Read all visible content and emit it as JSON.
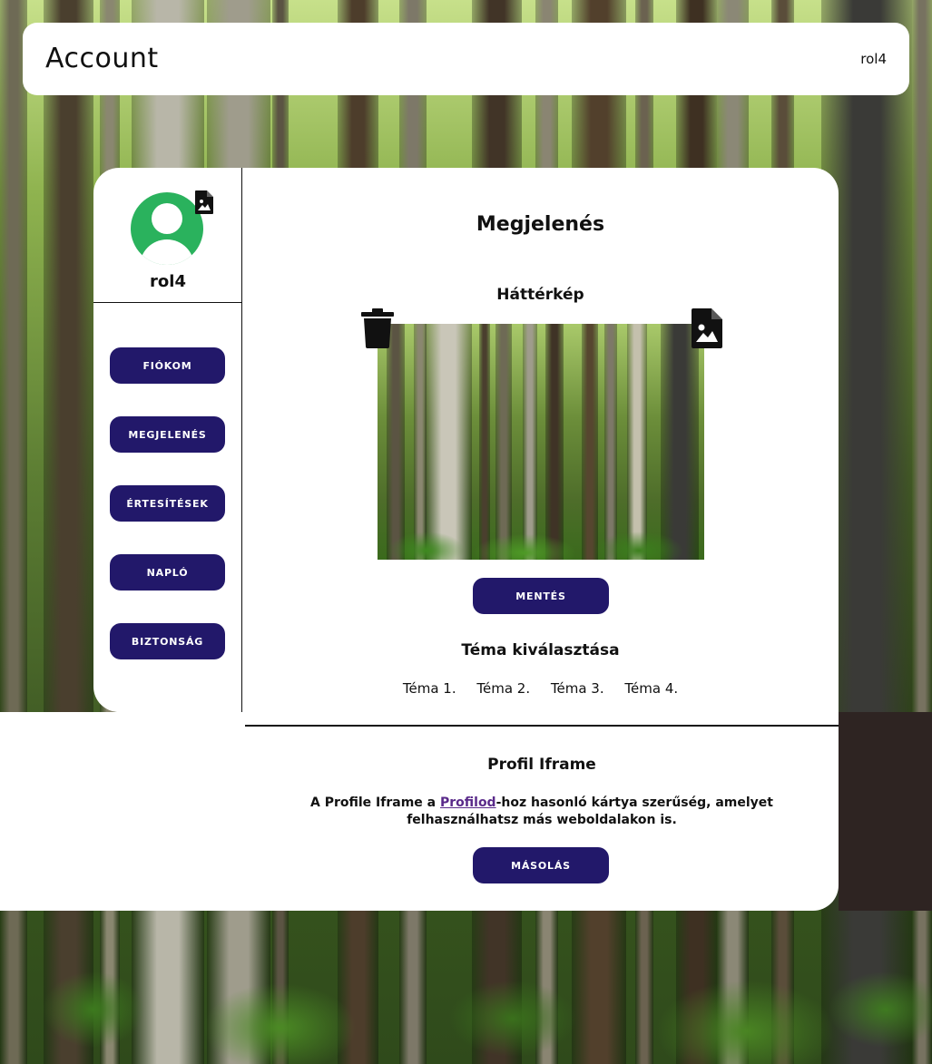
{
  "header": {
    "title": "Account",
    "username": "rol4"
  },
  "sidebar": {
    "username": "rol4",
    "items": [
      {
        "label": "FIÓKOM"
      },
      {
        "label": "MEGJELENÉS"
      },
      {
        "label": "ÉRTESÍTÉSEK"
      },
      {
        "label": "NAPLÓ"
      },
      {
        "label": "BIZTONSÁG"
      }
    ]
  },
  "main": {
    "title": "Megjelenés",
    "background_title": "Háttérkép",
    "save_label": "MENTÉS",
    "theme_title": "Téma kiválasztása",
    "themes": [
      "Téma 1.",
      "Téma 2.",
      "Téma 3.",
      "Téma 4."
    ]
  },
  "iframe": {
    "title": "Profil Iframe",
    "desc_before": "A Profile Iframe a ",
    "desc_link": "Profilod",
    "desc_after": "-hoz hasonló kártya szerűség, amelyet felhasználhatsz más weboldalakon is.",
    "copy_label": "MÁSOLÁS"
  },
  "colors": {
    "button": "#22186a",
    "avatar": "#2ab25d",
    "link": "#5a2a8a",
    "dark_block": "#2e2422"
  },
  "icons": {
    "avatar_edit": "image-file-icon",
    "delete": "trash-icon",
    "upload": "image-file-icon"
  }
}
